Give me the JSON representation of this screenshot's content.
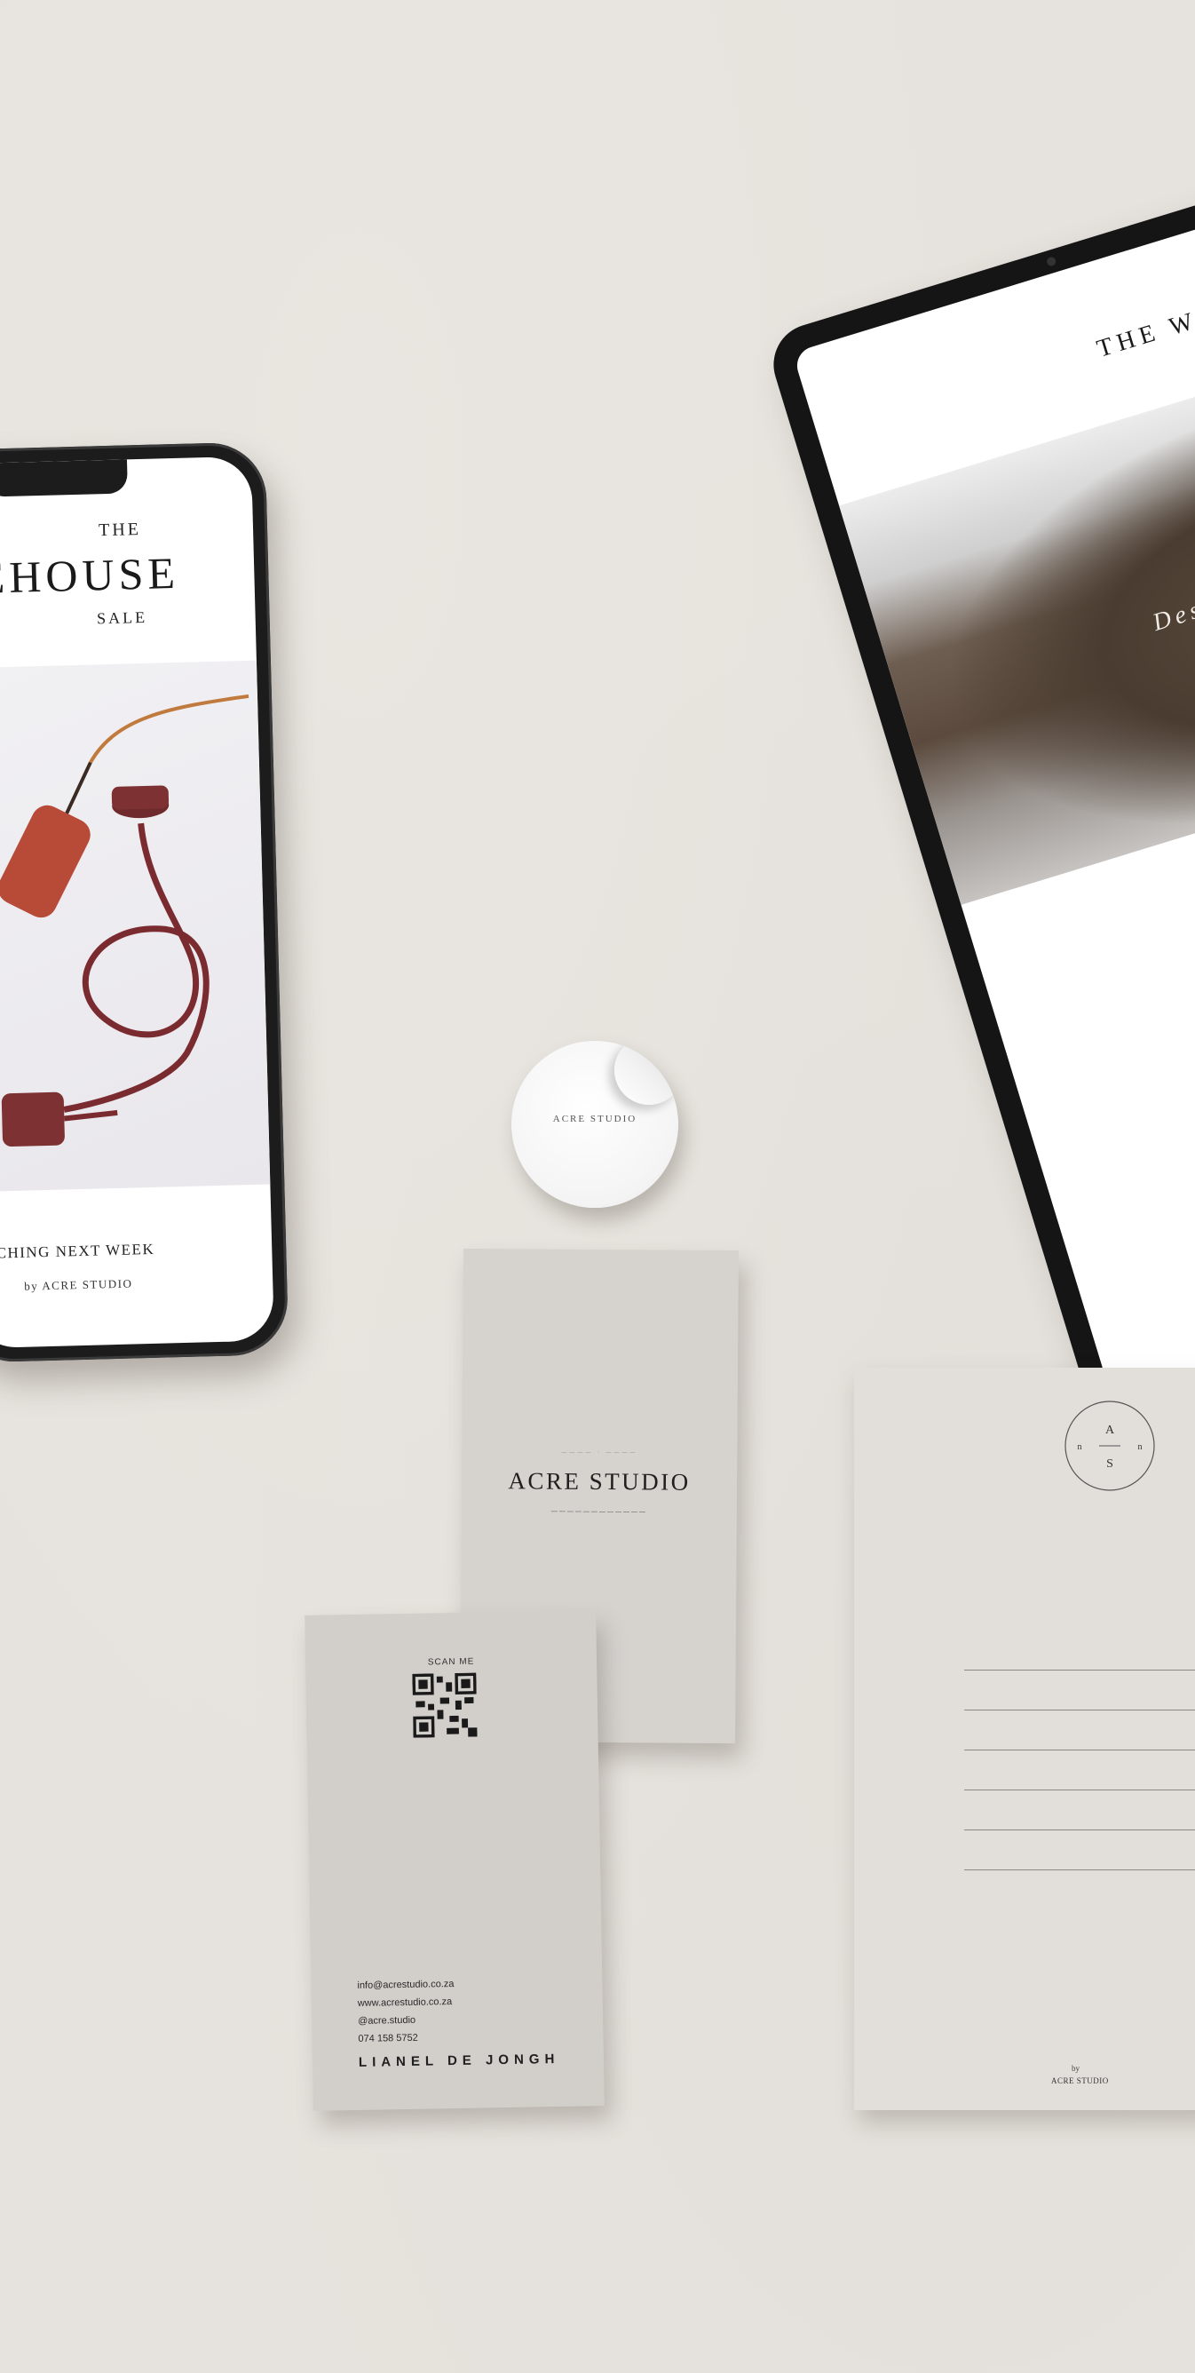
{
  "phone": {
    "line1": "THE",
    "title": "REHOUSE",
    "line3": "SALE",
    "launch": "AUNCHING NEXT WEEK",
    "byline": "by ACRE STUDIO"
  },
  "tablet": {
    "title": "THE WO",
    "tagline": "Design w"
  },
  "sticker": {
    "text": "ACRE STUDIO"
  },
  "card_front": {
    "name": "ACRE STUDIO"
  },
  "card_back": {
    "scan": "SCAN ME",
    "email": "info@acrestudio.co.za",
    "website": "www.acrestudio.co.za",
    "handle": "@acre.studio",
    "phone": "074 158 5752",
    "person": "LIANEL DE JONGH"
  },
  "postcard": {
    "monogram_top": "A",
    "monogram_bottom": "S",
    "monogram_left": "n",
    "monogram_right": "n",
    "by": "by",
    "studio": "ACRE STUDIO"
  },
  "colors": {
    "background": "#e6e2dd",
    "card": "#d6d3cf",
    "terracotta": "#b84b38",
    "burgundy": "#7a2b2f"
  }
}
